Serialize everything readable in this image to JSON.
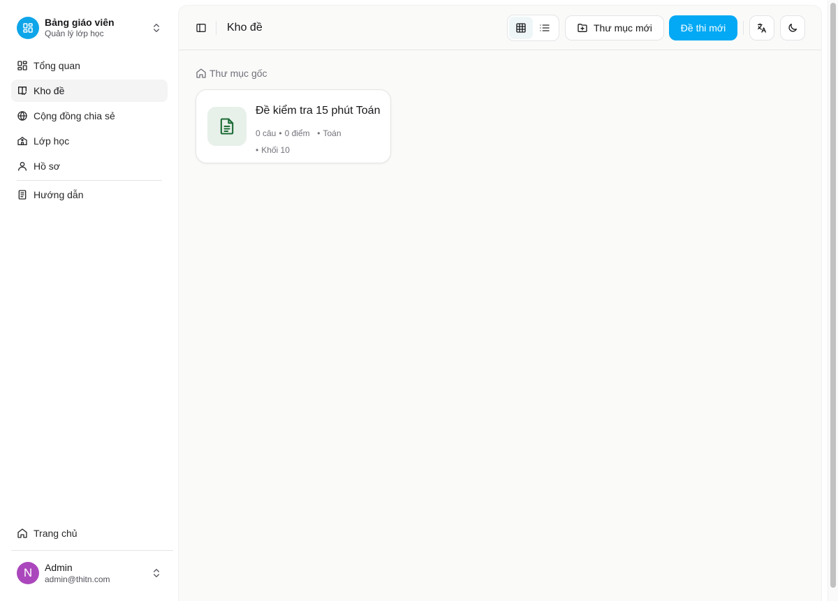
{
  "sidebar": {
    "brand": {
      "title": "Bảng giáo viên",
      "subtitle": "Quản lý lớp học"
    },
    "nav": [
      {
        "label": "Tổng quan",
        "icon": "dashboard-icon",
        "active": false
      },
      {
        "label": "Kho đề",
        "icon": "book-icon",
        "active": true
      },
      {
        "label": "Cộng đồng chia sẻ",
        "icon": "globe-icon",
        "active": false
      },
      {
        "label": "Lớp học",
        "icon": "school-icon",
        "active": false
      },
      {
        "label": "Hồ sơ",
        "icon": "user-icon",
        "active": false
      },
      {
        "label": "Hướng dẫn",
        "icon": "book-guide-icon",
        "active": false
      }
    ],
    "home": {
      "label": "Trang chủ",
      "icon": "home-icon"
    },
    "user": {
      "initial": "N",
      "name": "Admin",
      "email": "admin@thitn.com",
      "avatar_color": "#ab47bc"
    }
  },
  "header": {
    "title": "Kho đề",
    "view_mode": "grid",
    "new_folder_label": "Thư mục mới",
    "new_exam_label": "Đề thi mới",
    "primary_color": "#03a9f4"
  },
  "breadcrumb": {
    "label": "Thư mục gốc",
    "icon": "home-icon"
  },
  "exams": [
    {
      "title": "Đề kiểm tra 15 phút Toán",
      "questions": "0 câu",
      "points": "0 điểm",
      "subject": "Toán",
      "grade": "Khối 10",
      "icon": "document-icon",
      "icon_color": "#1b6b34"
    }
  ]
}
